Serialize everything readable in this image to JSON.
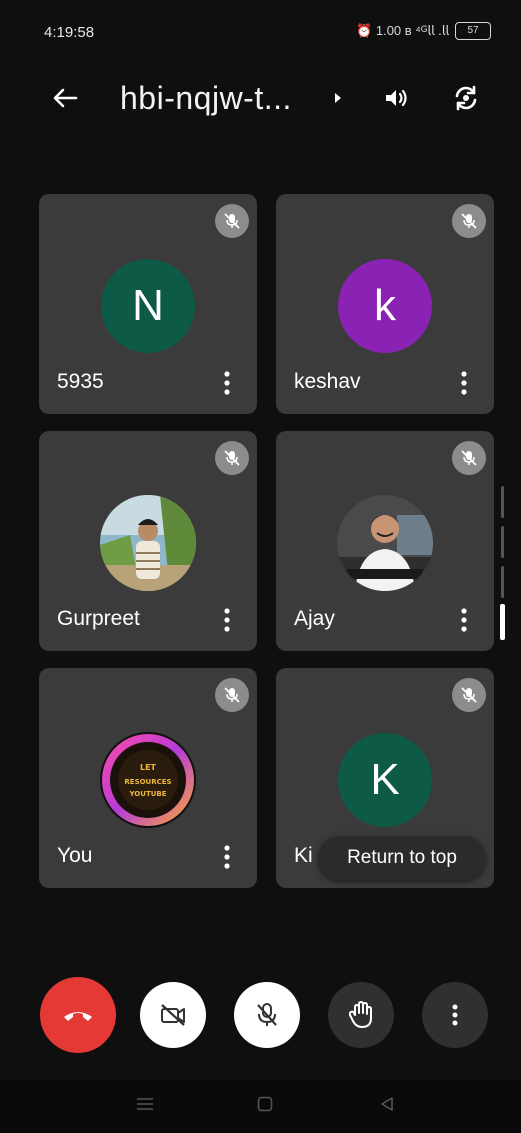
{
  "status_bar": {
    "time": "4:19:58",
    "icons_text": "⏰ 1.00 ʙ ⁴ᴳ𝗅𝗅 .𝗅𝗅",
    "battery": "57"
  },
  "header": {
    "title": "hbi-nqjw-t...",
    "back_icon": "arrow-left-icon",
    "audio_icon": "speaker-icon",
    "switch_icon": "switch-camera-icon"
  },
  "participants": [
    {
      "name": "5935",
      "avatar_letter": "N",
      "avatar_color": "#0d5a46",
      "muted": true
    },
    {
      "name": "keshav",
      "avatar_letter": "k",
      "avatar_color": "#8a22b3",
      "muted": true
    },
    {
      "name": "Gurpreet",
      "avatar_type": "photo",
      "muted": true
    },
    {
      "name": "Ajay",
      "avatar_type": "photo",
      "muted": true
    },
    {
      "name": "You",
      "avatar_type": "logo",
      "logo_text": [
        "LET",
        "RESOURCES",
        "YOUTUBE"
      ],
      "muted": true
    },
    {
      "name": "Ki",
      "avatar_letter": "K",
      "avatar_color": "#0d5a46",
      "muted": true
    }
  ],
  "toast": {
    "label": "Return to top"
  },
  "controls": {
    "hangup_color": "#e53935",
    "hangup_icon": "phone-hangup-icon",
    "camera_icon": "camera-off-icon",
    "mic_icon": "mic-off-icon",
    "hand_icon": "raise-hand-icon",
    "more_icon": "more-vert-icon"
  },
  "navbar": {
    "menu_icon": "menu-icon",
    "home_icon": "home-icon",
    "back_icon": "back-triangle-icon"
  }
}
